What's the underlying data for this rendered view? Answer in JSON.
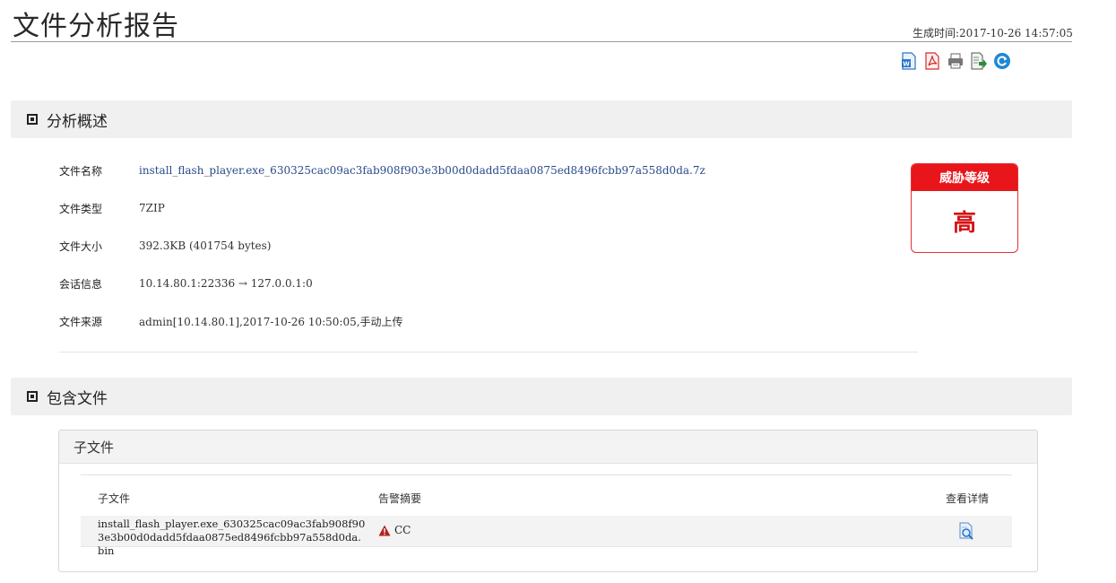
{
  "header": {
    "title": "文件分析报告",
    "generated_time": "生成时间:2017-10-26 14:57:05"
  },
  "toolbar": {
    "buttons": [
      {
        "icon": "word-export-icon",
        "color": "#2a73c9"
      },
      {
        "icon": "pdf-export-icon",
        "color": "#d42a2a"
      },
      {
        "icon": "print-icon",
        "color": "#555555"
      },
      {
        "icon": "excel-export-icon",
        "color": "#2e8b3a"
      },
      {
        "icon": "refresh-icon",
        "color": "#1e88d6"
      }
    ]
  },
  "overview": {
    "section_title": "分析概述",
    "rows": [
      {
        "key": "文件名称",
        "value": "install_flash_player.exe_630325cac09ac3fab908f903e3b00d0dadd5fdaa0875ed8496fcbb97a558d0da.7z"
      },
      {
        "key": "文件类型",
        "value": "7ZIP"
      },
      {
        "key": "文件大小",
        "value": "392.3KB (401754 bytes)"
      },
      {
        "key": "会话信息",
        "value": "10.14.80.1:22336 → 127.0.0.1:0"
      },
      {
        "key": "文件来源",
        "value": "admin[10.14.80.1],2017-10-26 10:50:05,手动上传"
      }
    ],
    "threat": {
      "label": "威胁等级",
      "level": "高",
      "accent_color": "#e8151b"
    }
  },
  "contained_files": {
    "section_title": "包含文件",
    "panel_title": "子文件",
    "columns": [
      "子文件",
      "告警摘要",
      "查看详情"
    ],
    "rows": [
      {
        "file": "install_flash_player.exe_630325cac09ac3fab908f903e3b00d0dadd5fdaa0875ed8496fcbb97a558d0da.bin",
        "alarm": "CC",
        "alarm_icon": "warning-icon",
        "detail_icon": "view-details-icon"
      }
    ]
  }
}
